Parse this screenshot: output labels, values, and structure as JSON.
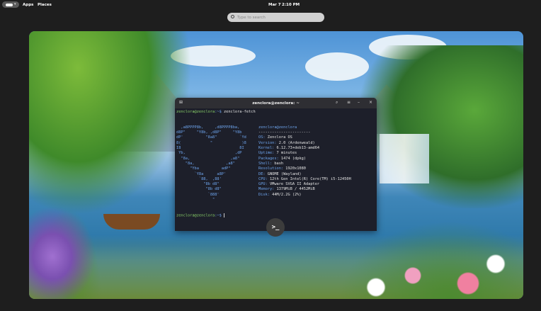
{
  "topbar": {
    "apps": "Apps",
    "places": "Places",
    "date": "Mar 7",
    "time": "2:10 PM"
  },
  "search": {
    "placeholder": "Type to search"
  },
  "terminal": {
    "title": "zenclora@zenclora: ~",
    "command_prompt_user": "zenclora@zenclora",
    "command_prompt_path": ":~$",
    "command": " zenclora-fetch",
    "art": [
      "  ,a8PPPP8b,     ,d8PPPP8ba,",
      "d8P\"     \"Y8b, ,d8P\"     \"Y8b",
      "dP'          \"8a8\"          `Yd",
      "8(             \"             )8",
      "I8                          8I",
      " Yb,                      ,dP",
      "  \"8a,                  ,a8\"",
      "    \"8a,              ,a8\"",
      "      \"Yba          adP\"",
      "        `Y8a      a8P'",
      "          `88,  ,88'",
      "            \"8b d8\"",
      "             \"8b d8\"",
      "              `888'",
      "                \""
    ],
    "info_header": "zenclora@zenclora",
    "info_sep": "-----------------------",
    "info": [
      {
        "label": "OS:",
        "value": " Zenclora OS"
      },
      {
        "label": "Version:",
        "value": " 2.0 (Ardenweald)"
      },
      {
        "label": "Kernel:",
        "value": " 6.12.73+deb13-amd64"
      },
      {
        "label": "Uptime:",
        "value": " 7 minutes"
      },
      {
        "label": "Packages:",
        "value": " 1474 (dpkg)"
      },
      {
        "label": "Shell:",
        "value": " bash"
      },
      {
        "label": "Resolution:",
        "value": " 1920x1080"
      },
      {
        "label": "DE:",
        "value": " GNOME (Wayland)"
      },
      {
        "label": "CPU:",
        "value": " 12th Gen Intel(R) Core(TM) i5-12450H"
      },
      {
        "label": "GPU:",
        "value": " VMware SVGA II Adapter"
      },
      {
        "label": "Memory:",
        "value": " 1379MiB / 4452MiB"
      },
      {
        "label": "Disk:",
        "value": " 44M/2.2G (2%)"
      }
    ]
  },
  "dock": {
    "terminal_glyph": ">_"
  }
}
